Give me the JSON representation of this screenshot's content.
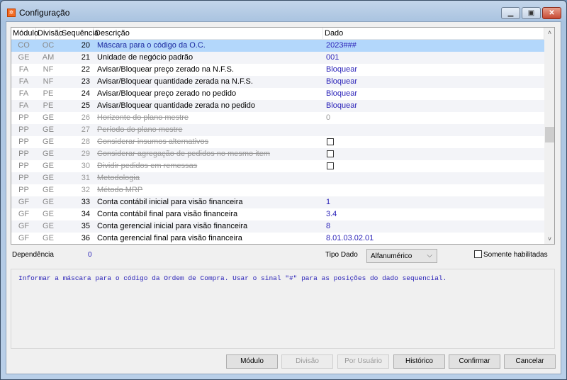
{
  "window": {
    "title": "Configuração",
    "icon": "app-logo-icon"
  },
  "grid": {
    "columns": [
      "Módulo",
      "Divisão",
      "Sequência",
      "Descrição",
      "Dado"
    ],
    "rows": [
      {
        "modulo": "CO",
        "divisao": "OC",
        "seq": "20",
        "descricao": "Máscara para o código da O.C.",
        "dado": "2023###",
        "selected": true,
        "enabled": true
      },
      {
        "modulo": "GE",
        "divisao": "AM",
        "seq": "21",
        "descricao": "Unidade de negócio padrão",
        "dado": "001",
        "enabled": true
      },
      {
        "modulo": "FA",
        "divisao": "NF",
        "seq": "22",
        "descricao": "Avisar/Bloquear preço zerado na N.F.S.",
        "dado": "Bloquear",
        "enabled": true
      },
      {
        "modulo": "FA",
        "divisao": "NF",
        "seq": "23",
        "descricao": "Avisar/Bloquear quantidade zerada na N.F.S.",
        "dado": "Bloquear",
        "enabled": true
      },
      {
        "modulo": "FA",
        "divisao": "PE",
        "seq": "24",
        "descricao": "Avisar/Bloquear preço zerado no pedido",
        "dado": "Bloquear",
        "enabled": true
      },
      {
        "modulo": "FA",
        "divisao": "PE",
        "seq": "25",
        "descricao": "Avisar/Bloquear quantidade zerada no pedido",
        "dado": "Bloquear",
        "enabled": true
      },
      {
        "modulo": "PP",
        "divisao": "GE",
        "seq": "26",
        "descricao": "Horizonte do plano mestre",
        "dado": "0",
        "enabled": false
      },
      {
        "modulo": "PP",
        "divisao": "GE",
        "seq": "27",
        "descricao": "Período do plano mestre",
        "dado": "",
        "enabled": false
      },
      {
        "modulo": "PP",
        "divisao": "GE",
        "seq": "28",
        "descricao": "Considerar insumos alternativos",
        "dado": "",
        "checkbox": true,
        "enabled": false
      },
      {
        "modulo": "PP",
        "divisao": "GE",
        "seq": "29",
        "descricao": "Considerar agregação de pedidos no mesmo item",
        "dado": "",
        "checkbox": true,
        "enabled": false
      },
      {
        "modulo": "PP",
        "divisao": "GE",
        "seq": "30",
        "descricao": "Dividir pedidos em remessas",
        "dado": "",
        "checkbox": true,
        "enabled": false
      },
      {
        "modulo": "PP",
        "divisao": "GE",
        "seq": "31",
        "descricao": "Metodologia",
        "dado": "",
        "enabled": false
      },
      {
        "modulo": "PP",
        "divisao": "GE",
        "seq": "32",
        "descricao": "Método MRP",
        "dado": "",
        "enabled": false
      },
      {
        "modulo": "GF",
        "divisao": "GE",
        "seq": "33",
        "descricao": "Conta contábil inicial para visão financeira",
        "dado": "1",
        "enabled": true
      },
      {
        "modulo": "GF",
        "divisao": "GE",
        "seq": "34",
        "descricao": "Conta contábil final para visão financeira",
        "dado": "3.4",
        "enabled": true
      },
      {
        "modulo": "GF",
        "divisao": "GE",
        "seq": "35",
        "descricao": "Conta gerencial inicial para visão financeira",
        "dado": "8",
        "enabled": true
      },
      {
        "modulo": "GF",
        "divisao": "GE",
        "seq": "36",
        "descricao": "Conta gerencial final para visão financeira",
        "dado": "8.01.03.02.01",
        "enabled": true
      }
    ]
  },
  "form": {
    "dependencia_label": "Dependência",
    "dependencia_value": "0",
    "tipo_dado_label": "Tipo Dado",
    "tipo_dado_value": "Alfanumérico",
    "somente_habilitadas_label": "Somente habilitadas",
    "somente_habilitadas_checked": false,
    "description": "Informar a máscara para o código da Ordem de Compra. Usar o sinal \"#\" para as posições do dado sequencial."
  },
  "buttons": [
    {
      "label": "Módulo",
      "enabled": true
    },
    {
      "label": "Divisão",
      "enabled": false
    },
    {
      "label": "Por Usuário",
      "enabled": false
    },
    {
      "label": "Histórico",
      "enabled": true
    },
    {
      "label": "Confirmar",
      "enabled": true
    },
    {
      "label": "Cancelar",
      "enabled": true
    }
  ]
}
